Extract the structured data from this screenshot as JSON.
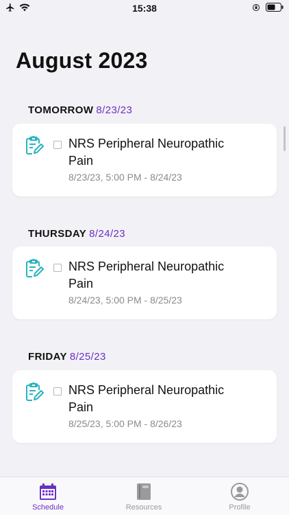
{
  "status_bar": {
    "time": "15:38"
  },
  "header": {
    "title": "August 2023"
  },
  "sections": [
    {
      "day": "TOMORROW",
      "date": "8/23/23",
      "item": {
        "title": "NRS Peripheral Neuropathic Pain",
        "time_range": "8/23/23, 5:00 PM - 8/24/23"
      }
    },
    {
      "day": "THURSDAY",
      "date": "8/24/23",
      "item": {
        "title": "NRS Peripheral Neuropathic Pain",
        "time_range": "8/24/23, 5:00 PM - 8/25/23"
      }
    },
    {
      "day": "FRIDAY",
      "date": "8/25/23",
      "item": {
        "title": "NRS Peripheral Neuropathic Pain",
        "time_range": "8/25/23, 5:00 PM - 8/26/23"
      }
    }
  ],
  "tabs": [
    {
      "label": "Schedule",
      "icon": "calendar-icon",
      "active": true
    },
    {
      "label": "Resources",
      "icon": "book-icon",
      "active": false
    },
    {
      "label": "Profile",
      "icon": "profile-icon",
      "active": false
    }
  ],
  "colors": {
    "accent": "#6b2fc4",
    "teal": "#28b3bf",
    "background": "#f2f2f6"
  }
}
